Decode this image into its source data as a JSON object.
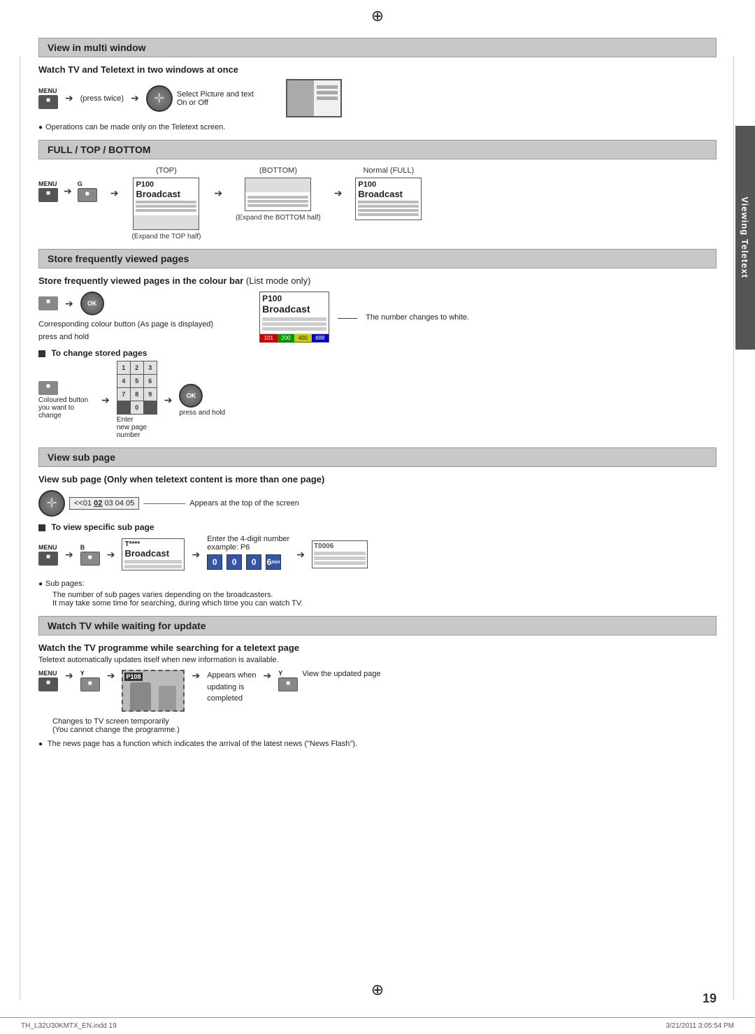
{
  "page": {
    "number": "19",
    "footer_left": "TH_L32U30KMTX_EN.indd 19",
    "footer_right": "3/21/2011  3:05:54 PM",
    "compass_symbol": "⊕"
  },
  "sidebar": {
    "label": "Viewing Teletext"
  },
  "section1": {
    "title": "View in multi window",
    "subtitle": "Watch TV and Teletext in two windows at once",
    "menu_label": "MENU",
    "press_twice": "(press twice)",
    "select_text": "Select Picture and text",
    "on_off": "On or Off",
    "note": "Operations can be made only on the Teletext screen."
  },
  "section2": {
    "title": "FULL / TOP / BOTTOM",
    "top_label": "(TOP)",
    "bottom_label": "(BOTTOM)",
    "normal_label": "Normal (FULL)",
    "p100": "P100",
    "broadcast": "Broadcast",
    "expand_top": "(Expand the TOP half)",
    "expand_bottom": "(Expand the BOTTOM half)",
    "menu_label": "MENU",
    "g_label": "G"
  },
  "section3": {
    "title": "Store frequently viewed pages",
    "subtitle": "Store frequently viewed pages in the colour bar",
    "list_mode": "(List mode only)",
    "p100": "P100",
    "broadcast": "Broadcast",
    "colour_btn_desc": "Corresponding colour button (As page is displayed)",
    "press_hold": "press and hold",
    "number_changes": "The number changes to white.",
    "change_stored_title": "To change stored pages",
    "colour_btn_label": "Coloured button you want to change",
    "enter_label": "Enter",
    "new_page": "new page",
    "number_label": "number",
    "press_hold2": "press and hold",
    "colour_bar_nums": [
      "101",
      "200",
      "400",
      "888"
    ]
  },
  "section4": {
    "title": "View sub page",
    "subtitle": "View sub page (Only when teletext content is more than one page)",
    "subpage_text": "<<01 02 03 04 05",
    "subpage_highlight": "02",
    "appears_text": "Appears at the top of the screen",
    "specific_title": "To view specific sub page",
    "menu_label": "MENU",
    "b_label": "B",
    "t_label": "T****",
    "broadcast": "Broadcast",
    "enter_4digit": "Enter the 4-digit number",
    "example": "example: P6",
    "t0006": "T0006",
    "digit0a": "0",
    "digit0b": "0",
    "digit0c": "0",
    "digit6": "6",
    "sub_pages_label": "Sub pages:",
    "sub_note1": "The number of sub pages varies depending on the broadcasters.",
    "sub_note2": "It may take some time for searching, during which time you can watch TV."
  },
  "section5": {
    "title": "Watch TV while waiting for update",
    "subtitle": "Watch the TV programme while searching for a teletext page",
    "auto_update": "Teletext automatically updates itself when new information is available.",
    "menu_label": "MENU",
    "y_label": "Y",
    "p108": "P108",
    "appears_when": "Appears when",
    "updating_is": "updating is",
    "completed": "completed",
    "y_label2": "Y",
    "view_updated": "View the updated page",
    "changes_tv": "Changes to TV screen temporarily",
    "cannot_change": "(You cannot change the programme.)",
    "news_flash": "The news page has a function which indicates the arrival of the latest news (\"News Flash\")."
  }
}
